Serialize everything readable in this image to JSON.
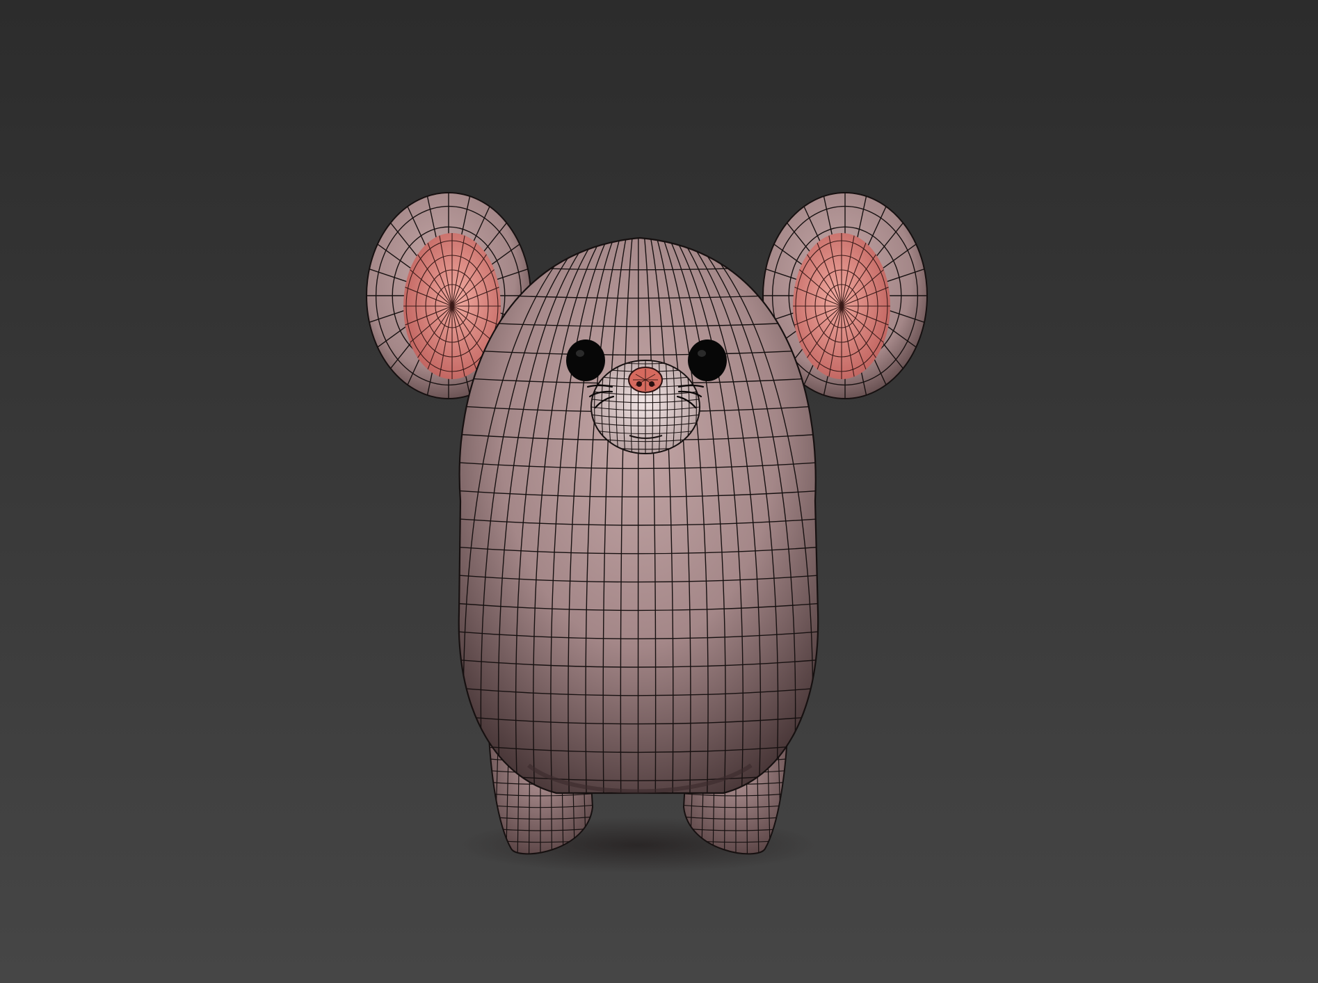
{
  "scene": {
    "subject": "mouse-character-wireframe-model",
    "colors": {
      "background_top": "#2c2c2c",
      "background_bottom": "#464646",
      "body_light": "#c3a6a6",
      "body_mid": "#a48788",
      "body_dark": "#4a3839",
      "ear_inner_light": "#f0aaa0",
      "ear_inner_dark": "#c0625e",
      "snout": "#e8dada",
      "nose": "#d66a5e",
      "eye": "#070707",
      "wire": "#161010"
    }
  }
}
